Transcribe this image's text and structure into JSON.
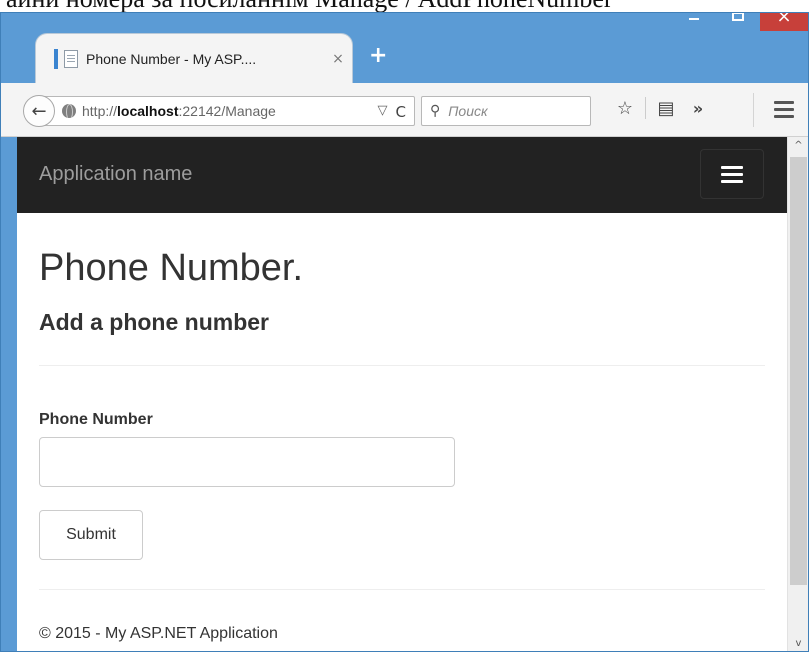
{
  "doc_fragment": "аини номера за посиланнім Manage / AddPhoneNumber",
  "window": {
    "caption_buttons": [
      "minimize",
      "maximize",
      "close"
    ],
    "close_glyph": "×"
  },
  "tab": {
    "title": "Phone Number - My ASP....",
    "close_glyph": "×",
    "new_tab_glyph": "+"
  },
  "toolbar": {
    "back_glyph": "←",
    "url_prefix": "http://",
    "url_host": "localhost",
    "url_rest": ":22142/Manage",
    "dropdown_glyph": "▽",
    "reload_glyph": "C",
    "search_glyph": "⚲",
    "search_placeholder": "Поиск",
    "bookmark_glyph": "☆",
    "reader_glyph": "▤",
    "overflow_glyph": "»"
  },
  "app": {
    "brand": "Application name",
    "page_title": "Phone Number.",
    "subtitle": "Add a phone number",
    "field_label": "Phone Number",
    "field_value": "",
    "submit_label": "Submit",
    "footer": "© 2015 - My ASP.NET Application"
  },
  "scrollbar": {
    "up_glyph": "^",
    "down_glyph": "v"
  },
  "colors": {
    "window_frame": "#5b9bd5",
    "close_button": "#c7403a",
    "navbar": "#222222",
    "brand_text": "#9d9d9d"
  }
}
